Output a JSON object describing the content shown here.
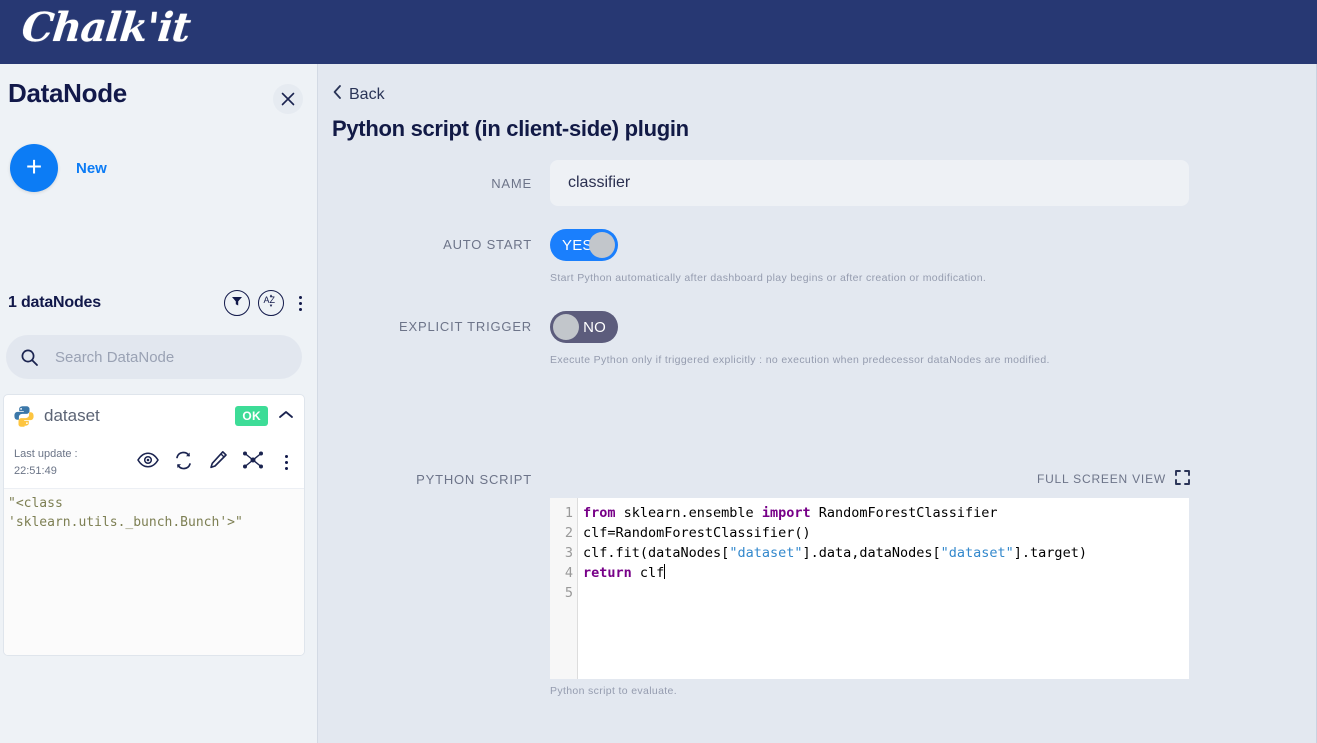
{
  "app": {
    "logo_text": "Chalk'it",
    "header_color": "#273873",
    "accent_blue": "#0c7cf5",
    "toggle_on_color": "#1a7ffd",
    "toggle_off_color": "#5c5c7c",
    "ok_badge_color": "#3ddc97"
  },
  "sidebar": {
    "title": "DataNode",
    "close_icon": "close-icon",
    "new_button_label": "New",
    "new_button_icon": "plus-icon",
    "count_label": "1 dataNodes",
    "filter_icon": "filter-icon",
    "sort_icon": "sort-az-icon",
    "more_icon": "more-vertical-icon",
    "search": {
      "icon": "search-icon",
      "value": "",
      "placeholder": "Search DataNode"
    },
    "node": {
      "type_icon": "python-icon",
      "name": "dataset",
      "status": "OK",
      "collapse_icon": "chevron-up-icon",
      "last_update_label": "Last update :",
      "last_update_time": "22:51:49",
      "actions": [
        {
          "name": "eye-icon",
          "label": "Preview"
        },
        {
          "name": "refresh-icon",
          "label": "Refresh"
        },
        {
          "name": "pencil-icon",
          "label": "Edit"
        },
        {
          "name": "graph-icon",
          "label": "Graph"
        },
        {
          "name": "more-vertical-icon",
          "label": "More"
        }
      ],
      "preview_text": "\"<class\n'sklearn.utils._bunch.Bunch'>\""
    }
  },
  "main": {
    "back_label": "Back",
    "back_icon": "chevron-left-icon",
    "page_title": "Python script (in client-side) plugin",
    "fields": {
      "name": {
        "label": "NAME",
        "value": "classifier",
        "placeholder": ""
      },
      "auto_start": {
        "label": "AUTO START",
        "value": "YES",
        "state": "on",
        "hint": "Start Python automatically after dashboard play begins or after creation or modification."
      },
      "explicit_trigger": {
        "label": "EXPLICIT TRIGGER",
        "value": "NO",
        "state": "off",
        "hint": "Execute Python only if triggered explicitly : no execution when predecessor dataNodes are modified."
      },
      "python_script": {
        "label": "PYTHON SCRIPT",
        "fullscreen_label": "FULL SCREEN VIEW",
        "fullscreen_icon": "expand-icon",
        "hint": "Python script to evaluate.",
        "line_numbers": "1\n2\n3\n4\n5",
        "code_lines": [
          "from sklearn.ensemble import RandomForestClassifier",
          "clf=RandomForestClassifier()",
          "clf.fit(dataNodes[\"dataset\"].data,dataNodes[\"dataset\"].target)",
          "return clf",
          ""
        ]
      }
    }
  }
}
